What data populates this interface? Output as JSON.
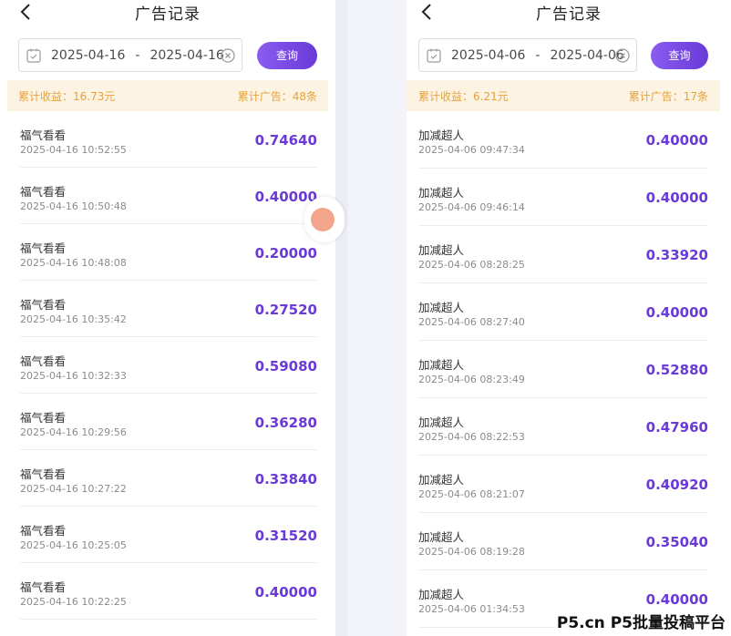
{
  "left": {
    "title": "广告记录",
    "date_start": "2025-04-16",
    "date_sep": "-",
    "date_end": "2025-04-16",
    "query_label": "查询",
    "summary_income": "累计收益：16.73元",
    "summary_ads": "累计广告：48条",
    "records": [
      {
        "name": "福气看看",
        "time": "2025-04-16 10:52:55",
        "amount": "0.74640"
      },
      {
        "name": "福气看看",
        "time": "2025-04-16 10:50:48",
        "amount": "0.40000"
      },
      {
        "name": "福气看看",
        "time": "2025-04-16 10:48:08",
        "amount": "0.20000"
      },
      {
        "name": "福气看看",
        "time": "2025-04-16 10:35:42",
        "amount": "0.27520"
      },
      {
        "name": "福气看看",
        "time": "2025-04-16 10:32:33",
        "amount": "0.59080"
      },
      {
        "name": "福气看看",
        "time": "2025-04-16 10:29:56",
        "amount": "0.36280"
      },
      {
        "name": "福气看看",
        "time": "2025-04-16 10:27:22",
        "amount": "0.33840"
      },
      {
        "name": "福气看看",
        "time": "2025-04-16 10:25:05",
        "amount": "0.31520"
      },
      {
        "name": "福气看看",
        "time": "2025-04-16 10:22:25",
        "amount": "0.40000"
      }
    ]
  },
  "right": {
    "title": "广告记录",
    "date_start": "2025-04-06",
    "date_sep": "-",
    "date_end": "2025-04-06",
    "query_label": "查询",
    "summary_income": "累计收益：6.21元",
    "summary_ads": "累计广告：17条",
    "records": [
      {
        "name": "加减超人",
        "time": "2025-04-06 09:47:34",
        "amount": "0.40000"
      },
      {
        "name": "加减超人",
        "time": "2025-04-06 09:46:14",
        "amount": "0.40000"
      },
      {
        "name": "加减超人",
        "time": "2025-04-06 08:28:25",
        "amount": "0.33920"
      },
      {
        "name": "加减超人",
        "time": "2025-04-06 08:27:40",
        "amount": "0.40000"
      },
      {
        "name": "加减超人",
        "time": "2025-04-06 08:23:49",
        "amount": "0.52880"
      },
      {
        "name": "加减超人",
        "time": "2025-04-06 08:22:53",
        "amount": "0.47960"
      },
      {
        "name": "加减超人",
        "time": "2025-04-06 08:21:07",
        "amount": "0.40920"
      },
      {
        "name": "加减超人",
        "time": "2025-04-06 08:19:28",
        "amount": "0.35040"
      },
      {
        "name": "加减超人",
        "time": "2025-04-06 01:34:53",
        "amount": "0.40000"
      }
    ]
  },
  "watermark": "P5.cn P5批量投稿平台",
  "colors": {
    "accent": "#6a3ad8",
    "summary_bg": "#fdf3e3",
    "summary_text": "#e6a23c"
  },
  "icons": {
    "back": "chevron-left-icon",
    "calendar": "calendar-icon",
    "clear": "clear-icon"
  }
}
